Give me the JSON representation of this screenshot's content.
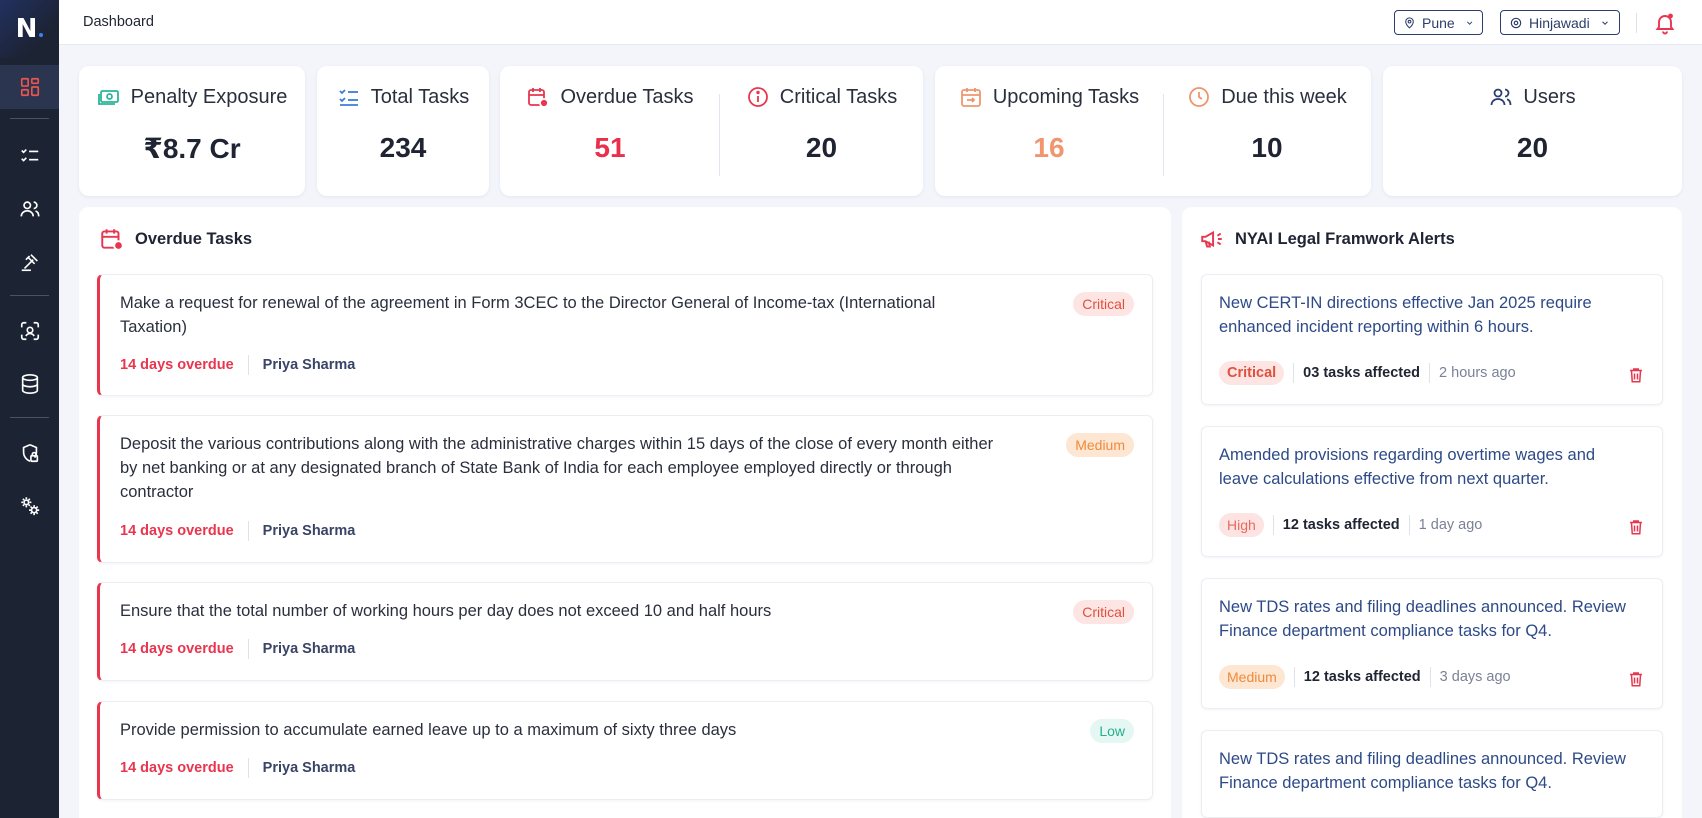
{
  "app": {
    "logo_letter": "N"
  },
  "sidebar": {
    "items": [
      {
        "icon": "dashboard-icon",
        "active": true
      },
      {
        "icon": "task-list-icon"
      },
      {
        "icon": "users-icon"
      },
      {
        "icon": "gavel-icon"
      },
      {
        "icon": "scan-icon"
      },
      {
        "icon": "database-icon"
      },
      {
        "icon": "shield-lock-icon"
      },
      {
        "icon": "settings-cogs-icon"
      }
    ]
  },
  "header": {
    "title": "Dashboard",
    "city": "Pune",
    "area": "Hinjawadi"
  },
  "stats": {
    "penalty": {
      "label": "Penalty Exposure",
      "value": "₹8.7 Cr"
    },
    "total": {
      "label": "Total Tasks",
      "value": "234"
    },
    "overdue": {
      "label": "Overdue Tasks",
      "value": "51"
    },
    "critical": {
      "label": "Critical Tasks",
      "value": "20"
    },
    "upcoming": {
      "label": "Upcoming Tasks",
      "value": "16"
    },
    "due_week": {
      "label": "Due this week",
      "value": "10"
    },
    "users": {
      "label": "Users",
      "value": "20"
    }
  },
  "overdue_panel": {
    "title": "Overdue Tasks",
    "tasks": [
      {
        "text": "Make a request for renewal of the agreement in Form 3CEC to the Director General of Income-tax (International Taxation)",
        "overdue": "14 days overdue",
        "assignee": "Priya Sharma",
        "priority": "Critical"
      },
      {
        "text": "Deposit the various contributions along with the administrative charges within 15 days of the close of every month either by net banking or at any designated branch of State Bank of India for each employee employed directly or through contractor",
        "overdue": "14 days overdue",
        "assignee": "Priya Sharma",
        "priority": "Medium"
      },
      {
        "text": "Ensure that the total number of working hours per day does not exceed 10 and half hours",
        "overdue": "14 days overdue",
        "assignee": "Priya Sharma",
        "priority": "Critical"
      },
      {
        "text": "Provide permission to accumulate earned leave up to a maximum of sixty three days",
        "overdue": "14 days overdue",
        "assignee": "Priya Sharma",
        "priority": "Low"
      }
    ]
  },
  "alerts_panel": {
    "title": "NYAI Legal Framwork Alerts",
    "alerts": [
      {
        "text": "New CERT-IN directions effective Jan 2025 require enhanced incident reporting within 6 hours.",
        "severity": "Critical",
        "affected": "03 tasks affected",
        "ago": "2 hours ago"
      },
      {
        "text": "Amended provisions regarding overtime wages and leave calculations effective from next quarter.",
        "severity": "High",
        "affected": "12 tasks affected",
        "ago": "1 day ago"
      },
      {
        "text": "New TDS rates and filing deadlines announced. Review Finance department compliance tasks for Q4.",
        "severity": "Medium",
        "affected": "12 tasks affected",
        "ago": "3 days ago"
      },
      {
        "text": "New TDS rates and filing deadlines announced. Review Finance department compliance tasks for Q4."
      }
    ]
  },
  "colors": {
    "sidebar_bg": "#1c2333",
    "accent_red": "#e8364f",
    "accent_orange": "#f0956d",
    "alert_text": "#2d4a87"
  }
}
